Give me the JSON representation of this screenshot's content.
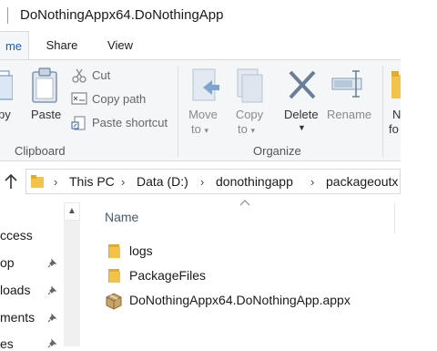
{
  "window": {
    "title": "DoNothingAppx64.DoNothingApp"
  },
  "tabs": [
    {
      "label": "me",
      "active": true
    },
    {
      "label": "Share",
      "active": false
    },
    {
      "label": "View",
      "active": false
    }
  ],
  "ribbon": {
    "clipboard": {
      "group_label": "Clipboard",
      "copy_label": "py",
      "paste_label": "Paste",
      "cut_label": "Cut",
      "copy_path_label": "Copy path",
      "paste_shortcut_label": "Paste shortcut"
    },
    "organize": {
      "group_label": "Organize",
      "move_to_label_1": "Move",
      "move_to_label_2": "to",
      "copy_to_label_1": "Copy",
      "copy_to_label_2": "to",
      "delete_label": "Delete",
      "rename_label": "Rename",
      "new_folder_label_1": "N",
      "new_folder_label_2": "fo"
    }
  },
  "address": {
    "crumbs": [
      "This PC",
      "Data (D:)",
      "donothingapp",
      "packageoutx"
    ]
  },
  "nav_pane": {
    "items": [
      {
        "label": "ccess",
        "pinned": false
      },
      {
        "label": "op",
        "pinned": true
      },
      {
        "label": "loads",
        "pinned": true
      },
      {
        "label": "ments",
        "pinned": true
      },
      {
        "label": "es",
        "pinned": true
      }
    ]
  },
  "content": {
    "column_name": "Name",
    "files": [
      {
        "name": "logs",
        "type": "folder"
      },
      {
        "name": "PackageFiles",
        "type": "folder"
      },
      {
        "name": "DoNothingAppx64.DoNothingApp.appx",
        "type": "package"
      }
    ]
  },
  "colors": {
    "accent": "#1a5fb4",
    "folder": "#f3c24b",
    "ribbon_bg": "#f5f6f7"
  }
}
